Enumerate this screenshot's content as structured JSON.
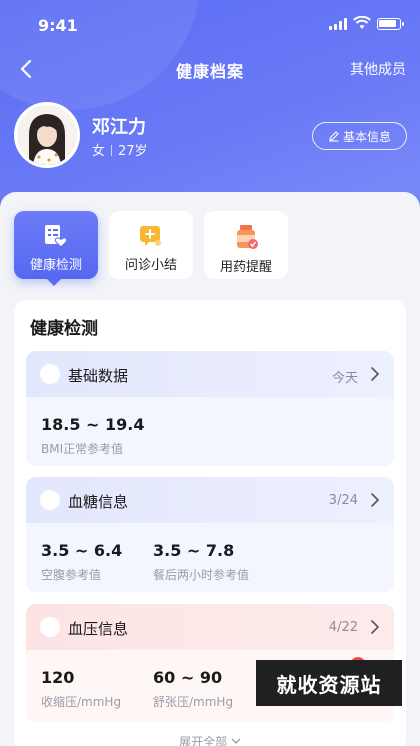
{
  "status_bar": {
    "time": "9:41"
  },
  "nav": {
    "title": "健康档案",
    "right_label": "其他成员"
  },
  "profile": {
    "name": "邓江力",
    "gender": "女",
    "age": "27岁",
    "basic_info_label": "基本信息"
  },
  "tabs": [
    {
      "label": "健康检测",
      "icon": "health-check-icon",
      "active": true
    },
    {
      "label": "问诊小结",
      "icon": "consult-summary-icon",
      "active": false
    },
    {
      "label": "用药提醒",
      "icon": "medicine-reminder-icon",
      "active": false
    }
  ],
  "panel": {
    "title": "健康检测",
    "cards": [
      {
        "title": "基础数据",
        "right": "今天",
        "metrics": [
          {
            "value": "18.5 ~ 19.4",
            "caption": "BMI正常参考值"
          }
        ]
      },
      {
        "title": "血糖信息",
        "right": "3/24",
        "metrics": [
          {
            "value": "3.5 ~ 6.4",
            "caption": "空腹参考值"
          },
          {
            "value": "3.5 ~ 7.8",
            "caption": "餐后两小时参考值"
          }
        ]
      },
      {
        "title": "血压信息",
        "right": "4/22",
        "metrics": [
          {
            "value": "120",
            "caption": "收缩压/mmHg"
          },
          {
            "value": "60 ~ 90",
            "caption": "舒张压/mmHg"
          }
        ]
      }
    ],
    "expand_label": "展开全部"
  },
  "watermark": "就收资源站",
  "colors": {
    "primary": "#5a6cf4",
    "blue_card": "#e3e7fd",
    "pink_card": "#fde4e4",
    "sheet_bg": "#f3f4f8"
  }
}
